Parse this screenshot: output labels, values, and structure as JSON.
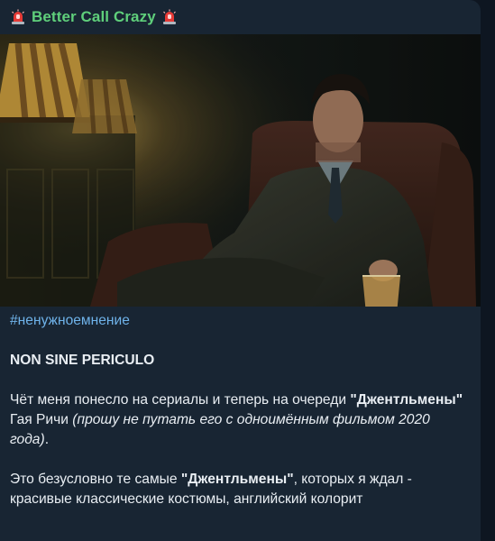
{
  "channel": {
    "name": "Better Call Crazy",
    "name_color": "#5fcf7b",
    "emoji_icon": "police-light-icon"
  },
  "photo": {
    "description_icon": "post-photo"
  },
  "post": {
    "hashtag": "#ненужноемнение",
    "heading": "NON SINE PERICULO",
    "p1_a": "Чёт меня понесло на сериалы и теперь на очереди ",
    "p1_b": "\"Джентльмены\"",
    "p1_c": " Гая Ричи ",
    "p1_d": "(прошу не путать его с одноимённым фильмом 2020 года)",
    "p1_e": ".",
    "p2_a": "Это безусловно те самые ",
    "p2_b": "\"Джентльмены\"",
    "p2_c": ", которых я ждал - красивые классические костюмы, английский колорит"
  },
  "colors": {
    "bubble": "#182533",
    "background": "#0e1621",
    "link": "#6fb3ea",
    "text": "#e9eef3"
  }
}
